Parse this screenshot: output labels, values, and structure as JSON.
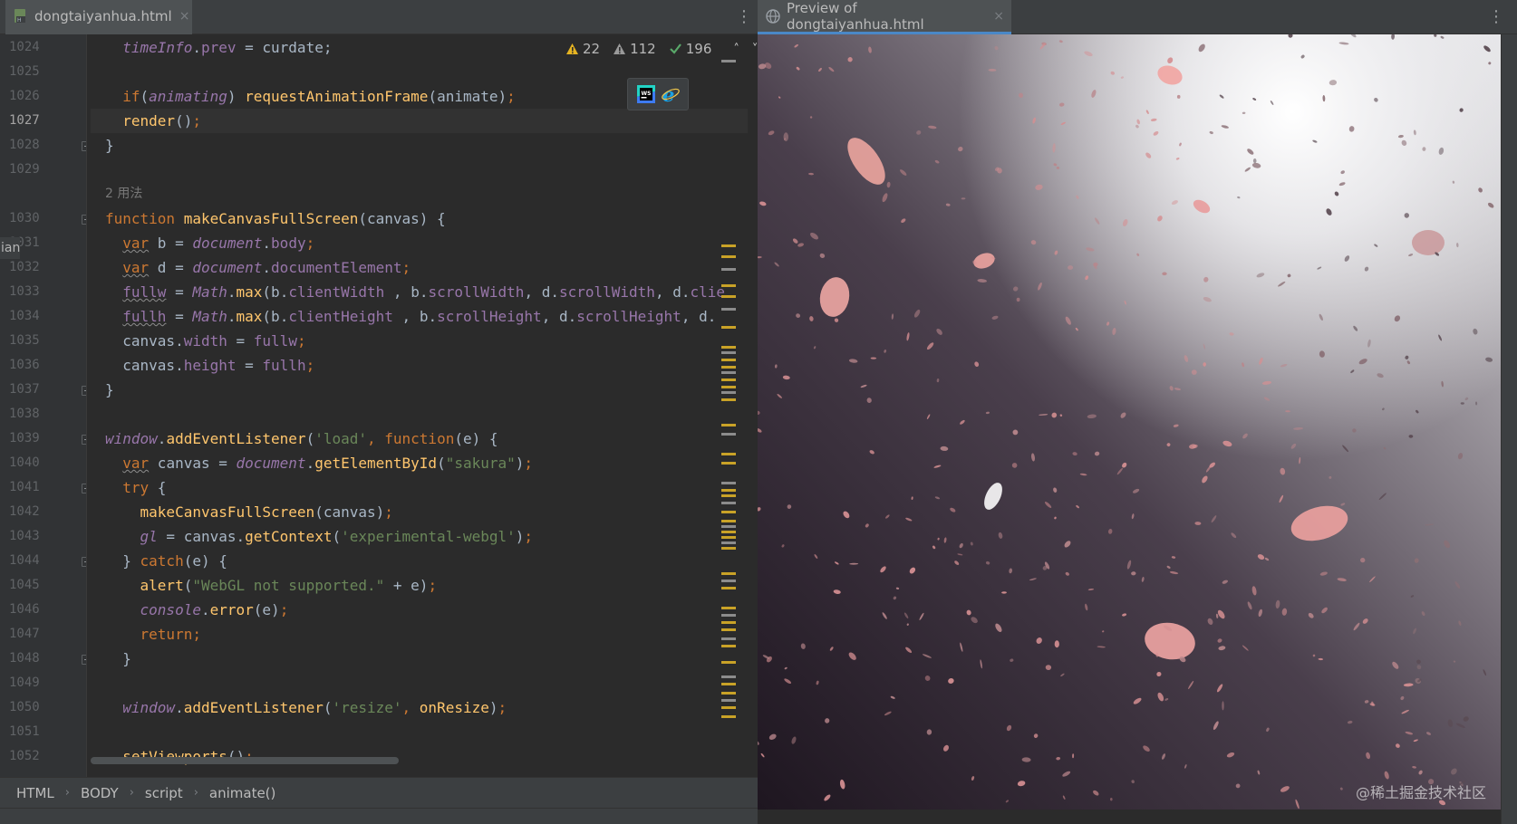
{
  "editor": {
    "tab_title": "dongtaiyanhua.html",
    "tab_close": "×",
    "menu_glyph": "⋮",
    "inspections": {
      "warnings": "22",
      "weak_warnings": "112",
      "typos": "196"
    },
    "side_fragment": "ian",
    "lines": [
      {
        "n": "1024",
        "tokens": [
          [
            "  ",
            "plain"
          ],
          [
            "timeInfo",
            "glob"
          ],
          [
            ".",
            "plain"
          ],
          [
            "prev",
            "prop"
          ],
          [
            " = curdate;",
            "plain"
          ]
        ]
      },
      {
        "n": "1025",
        "tokens": []
      },
      {
        "n": "1026",
        "tokens": [
          [
            "  ",
            "plain"
          ],
          [
            "if",
            "kw"
          ],
          [
            "(",
            "plain"
          ],
          [
            "animating",
            "glob"
          ],
          [
            ") ",
            "plain"
          ],
          [
            "requestAnimationFrame",
            "fn"
          ],
          [
            "(animate)",
            "plain"
          ],
          [
            ";",
            "kw"
          ]
        ]
      },
      {
        "n": "1027",
        "current": true,
        "tokens": [
          [
            "  ",
            "plain"
          ],
          [
            "render",
            "fn"
          ],
          [
            "()",
            "plain"
          ],
          [
            ";",
            "kw"
          ]
        ]
      },
      {
        "n": "1028",
        "fold": true,
        "tokens": [
          [
            "}",
            "plain"
          ]
        ]
      },
      {
        "n": "1029",
        "tokens": []
      },
      {
        "hint": "2 用法"
      },
      {
        "n": "1030",
        "fold": true,
        "tokens": [
          [
            "function ",
            "kw"
          ],
          [
            "makeCanvasFullScreen",
            "fn"
          ],
          [
            "(canvas) {",
            "plain"
          ]
        ]
      },
      {
        "n": "1031",
        "tokens": [
          [
            "  ",
            "plain"
          ],
          [
            "var",
            "kw und"
          ],
          [
            " b = ",
            "plain"
          ],
          [
            "document",
            "glob"
          ],
          [
            ".",
            "plain"
          ],
          [
            "body",
            "prop"
          ],
          [
            ";",
            "kw"
          ]
        ]
      },
      {
        "n": "1032",
        "tokens": [
          [
            "  ",
            "plain"
          ],
          [
            "var",
            "kw und"
          ],
          [
            " d = ",
            "plain"
          ],
          [
            "document",
            "glob"
          ],
          [
            ".",
            "plain"
          ],
          [
            "documentElement",
            "prop"
          ],
          [
            ";",
            "kw"
          ]
        ]
      },
      {
        "n": "1033",
        "tokens": [
          [
            "  ",
            "plain"
          ],
          [
            "fullw",
            "prop und"
          ],
          [
            " = ",
            "plain"
          ],
          [
            "Math",
            "glob"
          ],
          [
            ".",
            "plain"
          ],
          [
            "max",
            "fn"
          ],
          [
            "(b.",
            "plain"
          ],
          [
            "clientWidth",
            "prop"
          ],
          [
            " , b.",
            "plain"
          ],
          [
            "scrollWidth",
            "prop"
          ],
          [
            ", d.",
            "plain"
          ],
          [
            "scrollWidth",
            "prop"
          ],
          [
            ", d.",
            "plain"
          ],
          [
            "clie",
            "prop"
          ]
        ]
      },
      {
        "n": "1034",
        "tokens": [
          [
            "  ",
            "plain"
          ],
          [
            "fullh",
            "prop und"
          ],
          [
            " = ",
            "plain"
          ],
          [
            "Math",
            "glob"
          ],
          [
            ".",
            "plain"
          ],
          [
            "max",
            "fn"
          ],
          [
            "(b.",
            "plain"
          ],
          [
            "clientHeight",
            "prop"
          ],
          [
            " , b.",
            "plain"
          ],
          [
            "scrollHeight",
            "prop"
          ],
          [
            ", d.",
            "plain"
          ],
          [
            "scrollHeight",
            "prop"
          ],
          [
            ", d.",
            "plain"
          ]
        ]
      },
      {
        "n": "1035",
        "tokens": [
          [
            "  canvas.",
            "plain"
          ],
          [
            "width",
            "prop"
          ],
          [
            " = ",
            "plain"
          ],
          [
            "fullw",
            "prop"
          ],
          [
            ";",
            "kw"
          ]
        ]
      },
      {
        "n": "1036",
        "tokens": [
          [
            "  canvas.",
            "plain"
          ],
          [
            "height",
            "prop"
          ],
          [
            " = ",
            "plain"
          ],
          [
            "fullh",
            "prop"
          ],
          [
            ";",
            "kw"
          ]
        ]
      },
      {
        "n": "1037",
        "fold": true,
        "tokens": [
          [
            "}",
            "plain"
          ]
        ]
      },
      {
        "n": "1038",
        "tokens": []
      },
      {
        "n": "1039",
        "fold": true,
        "tokens": [
          [
            "window",
            "glob"
          ],
          [
            ".",
            "plain"
          ],
          [
            "addEventListener",
            "fn"
          ],
          [
            "(",
            "plain"
          ],
          [
            "'load'",
            "str"
          ],
          [
            ", ",
            "kw"
          ],
          [
            "function",
            "kw"
          ],
          [
            "(e) {",
            "plain"
          ]
        ]
      },
      {
        "n": "1040",
        "tokens": [
          [
            "  ",
            "plain"
          ],
          [
            "var",
            "kw und"
          ],
          [
            " canvas = ",
            "plain"
          ],
          [
            "document",
            "glob"
          ],
          [
            ".",
            "plain"
          ],
          [
            "getElementById",
            "fn"
          ],
          [
            "(",
            "plain"
          ],
          [
            "\"sakura\"",
            "str"
          ],
          [
            ")",
            "plain"
          ],
          [
            ";",
            "kw"
          ]
        ]
      },
      {
        "n": "1041",
        "fold": true,
        "tokens": [
          [
            "  ",
            "plain"
          ],
          [
            "try",
            "kw"
          ],
          [
            " {",
            "plain"
          ]
        ]
      },
      {
        "n": "1042",
        "tokens": [
          [
            "    ",
            "plain"
          ],
          [
            "makeCanvasFullScreen",
            "fn"
          ],
          [
            "(canvas)",
            "plain"
          ],
          [
            ";",
            "kw"
          ]
        ]
      },
      {
        "n": "1043",
        "tokens": [
          [
            "    ",
            "plain"
          ],
          [
            "gl",
            "glob"
          ],
          [
            " = canvas.",
            "plain"
          ],
          [
            "getContext",
            "fn"
          ],
          [
            "(",
            "plain"
          ],
          [
            "'experimental-webgl'",
            "str"
          ],
          [
            ")",
            "plain"
          ],
          [
            ";",
            "kw"
          ]
        ]
      },
      {
        "n": "1044",
        "fold": true,
        "tokens": [
          [
            "  } ",
            "plain"
          ],
          [
            "catch",
            "kw"
          ],
          [
            "(e) {",
            "plain"
          ]
        ]
      },
      {
        "n": "1045",
        "tokens": [
          [
            "    ",
            "plain"
          ],
          [
            "alert",
            "fn"
          ],
          [
            "(",
            "plain"
          ],
          [
            "\"WebGL not supported.\"",
            "str"
          ],
          [
            " + e)",
            "plain"
          ],
          [
            ";",
            "kw"
          ]
        ]
      },
      {
        "n": "1046",
        "tokens": [
          [
            "    ",
            "plain"
          ],
          [
            "console",
            "glob"
          ],
          [
            ".",
            "plain"
          ],
          [
            "error",
            "fn"
          ],
          [
            "(e)",
            "plain"
          ],
          [
            ";",
            "kw"
          ]
        ]
      },
      {
        "n": "1047",
        "tokens": [
          [
            "    ",
            "plain"
          ],
          [
            "return",
            "kw"
          ],
          [
            ";",
            "kw"
          ]
        ]
      },
      {
        "n": "1048",
        "fold": true,
        "tokens": [
          [
            "  }",
            "plain"
          ]
        ]
      },
      {
        "n": "1049",
        "tokens": []
      },
      {
        "n": "1050",
        "tokens": [
          [
            "  ",
            "plain"
          ],
          [
            "window",
            "glob"
          ],
          [
            ".",
            "plain"
          ],
          [
            "addEventListener",
            "fn"
          ],
          [
            "(",
            "plain"
          ],
          [
            "'resize'",
            "str"
          ],
          [
            ", ",
            "kw"
          ],
          [
            "onResize",
            "fn"
          ],
          [
            ")",
            "plain"
          ],
          [
            ";",
            "kw"
          ]
        ]
      },
      {
        "n": "1051",
        "tokens": []
      },
      {
        "n": "1052",
        "tokens": [
          [
            "  ",
            "plain"
          ],
          [
            "setViewports",
            "fn"
          ],
          [
            "()",
            "plain"
          ],
          [
            ";",
            "kw"
          ]
        ]
      }
    ],
    "breadcrumb": [
      "HTML",
      "BODY",
      "script",
      "animate()"
    ],
    "breadcrumb_sep": "›"
  },
  "preview": {
    "tab_title": "Preview of dongtaiyanhua.html",
    "tab_close": "×",
    "menu_glyph": "⋮",
    "watermark": "@稀土掘金技术社区"
  },
  "colors": {
    "editor_bg": "#2b2b2b",
    "keyword": "#cc7832",
    "function": "#ffc66d",
    "string": "#6a8759",
    "global": "#9876aa",
    "warning": "#e6b422",
    "accent": "#4a88c7",
    "petal": "#e8a0a0"
  },
  "icons": [
    "file-html-icon",
    "warning-icon",
    "weak-warning-icon",
    "check-icon",
    "chevron-up-icon",
    "chevron-down-icon",
    "webstorm-browser-icon",
    "ie-browser-icon",
    "globe-icon",
    "more-icon"
  ]
}
